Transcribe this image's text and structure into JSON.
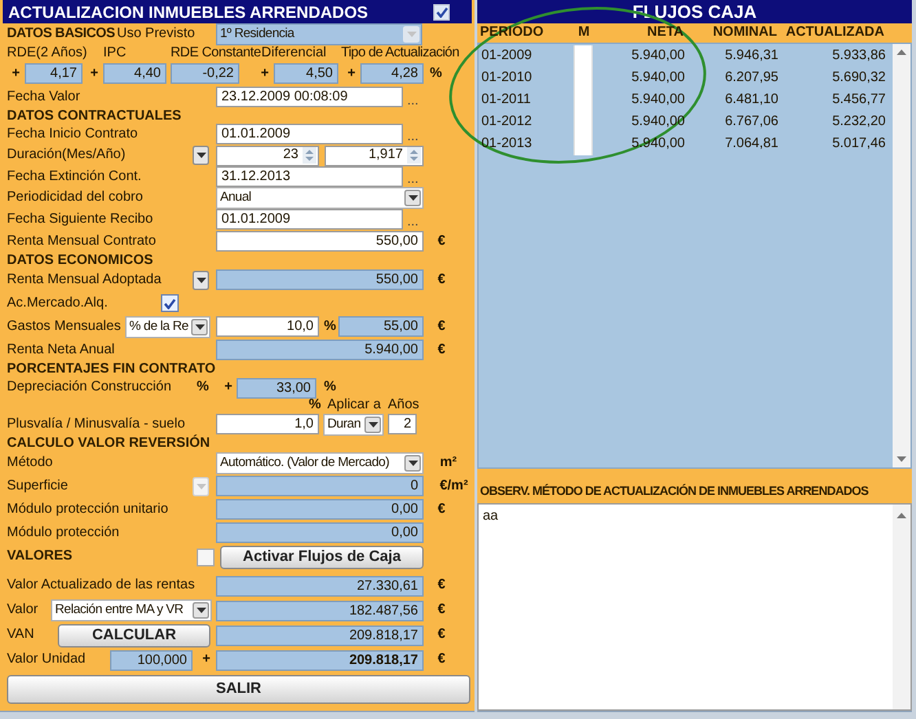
{
  "title": {
    "text": "ACTUALIZACION INMUEBLES ARRENDADOS",
    "checked": true
  },
  "form_rows": [
    {
      "items": [
        {
          "kind": "heading",
          "text": "DATOS BASICOS"
        },
        {
          "kind": "label",
          "text": "Uso Previsto"
        },
        {
          "kind": "select",
          "value": "1º Residencia",
          "editable": false,
          "disabled": true
        }
      ]
    },
    {
      "items": [
        {
          "kind": "label",
          "text": "RDE(2 Años)"
        },
        {
          "kind": "label",
          "text": "IPC"
        },
        {
          "kind": "label",
          "text": "RDE Constante"
        },
        {
          "kind": "label",
          "text": "Diferencial"
        },
        {
          "kind": "label",
          "text": "Tipo de Actualización"
        }
      ]
    },
    {
      "items": [
        {
          "kind": "sign",
          "text": "+"
        },
        {
          "kind": "field",
          "value": "4,17",
          "editable": false
        },
        {
          "kind": "sign",
          "text": "+"
        },
        {
          "kind": "field",
          "value": "4,40",
          "editable": false
        },
        {
          "kind": "field",
          "value": "-0,22",
          "editable": false
        },
        {
          "kind": "sign",
          "text": "+"
        },
        {
          "kind": "field",
          "value": "4,50",
          "editable": false
        },
        {
          "kind": "sign",
          "text": "+"
        },
        {
          "kind": "field",
          "value": "4,28",
          "editable": false
        },
        {
          "kind": "sign",
          "text": "%"
        }
      ]
    },
    {
      "items": [
        {
          "kind": "label",
          "text": "Fecha Valor"
        },
        {
          "kind": "field",
          "value": "23.12.2009 00:08:09",
          "editable": true
        },
        {
          "kind": "ellipsis_button",
          "text": "..."
        }
      ]
    },
    {
      "items": [
        {
          "kind": "heading",
          "text": "DATOS CONTRACTUALES"
        }
      ]
    },
    {
      "items": [
        {
          "kind": "label",
          "text": "Fecha Inicio Contrato"
        },
        {
          "kind": "field",
          "value": "01.01.2009",
          "editable": true
        },
        {
          "kind": "ellipsis_button",
          "text": "..."
        }
      ]
    },
    {
      "items": [
        {
          "kind": "label",
          "text": "Duración(Mes/Año)"
        },
        {
          "kind": "dropdown_button",
          "disabled": false
        },
        {
          "kind": "spinner",
          "value": "23"
        },
        {
          "kind": "spinner",
          "value": "1,917"
        }
      ]
    },
    {
      "items": [
        {
          "kind": "label",
          "text": "Fecha Extinción Cont."
        },
        {
          "kind": "field",
          "value": "31.12.2013",
          "editable": true
        },
        {
          "kind": "ellipsis_button",
          "text": "..."
        }
      ]
    },
    {
      "items": [
        {
          "kind": "label",
          "text": "Periodicidad del cobro"
        },
        {
          "kind": "select",
          "value": "Anual",
          "editable": true,
          "disabled": false
        }
      ]
    },
    {
      "items": [
        {
          "kind": "label",
          "text": "Fecha Siguiente Recibo"
        },
        {
          "kind": "field",
          "value": "01.01.2009",
          "editable": true
        },
        {
          "kind": "ellipsis_button",
          "text": "..."
        }
      ]
    },
    {
      "items": [
        {
          "kind": "label",
          "text": "Renta Mensual Contrato"
        },
        {
          "kind": "field",
          "value": "550,00",
          "editable": true
        },
        {
          "kind": "sign",
          "text": "€"
        }
      ]
    },
    {
      "items": [
        {
          "kind": "heading",
          "text": "DATOS ECONOMICOS"
        }
      ]
    },
    {
      "items": [
        {
          "kind": "label",
          "text": "Renta Mensual Adoptada"
        },
        {
          "kind": "dropdown_button",
          "disabled": false
        },
        {
          "kind": "field",
          "value": "550,00",
          "editable": false
        },
        {
          "kind": "sign",
          "text": "€"
        }
      ]
    },
    {
      "items": [
        {
          "kind": "label",
          "text": "Ac.Mercado.Alq."
        },
        {
          "kind": "checkbox",
          "checked": true
        }
      ]
    },
    {
      "items": [
        {
          "kind": "label",
          "text": "Gastos Mensuales"
        },
        {
          "kind": "select",
          "value": "% de la Re",
          "editable": true,
          "disabled": false
        },
        {
          "kind": "field",
          "value": "10,0",
          "editable": true
        },
        {
          "kind": "sign",
          "text": "%"
        },
        {
          "kind": "field",
          "value": "55,00",
          "editable": false
        },
        {
          "kind": "sign",
          "text": "€"
        }
      ]
    },
    {
      "items": [
        {
          "kind": "label",
          "text": "Renta Neta Anual"
        },
        {
          "kind": "field",
          "value": "5.940,00",
          "editable": false
        },
        {
          "kind": "sign",
          "text": "€"
        }
      ]
    },
    {
      "items": [
        {
          "kind": "heading",
          "text": "PORCENTAJES FIN CONTRATO"
        }
      ]
    },
    {
      "items": [
        {
          "kind": "label",
          "text": "Depreciación Construcción"
        },
        {
          "kind": "sign",
          "text": "%"
        },
        {
          "kind": "sign",
          "text": "+"
        },
        {
          "kind": "field",
          "value": "33,00",
          "editable": false
        },
        {
          "kind": "sign",
          "text": "%"
        }
      ]
    },
    {
      "items": [
        {
          "kind": "sign",
          "text": "%"
        },
        {
          "kind": "label",
          "text": "Aplicar a"
        },
        {
          "kind": "label",
          "text": "Años"
        }
      ]
    },
    {
      "items": [
        {
          "kind": "label",
          "text": "Plusvalía / Minusvalía - suelo"
        },
        {
          "kind": "field",
          "value": "1,0",
          "editable": true
        },
        {
          "kind": "select",
          "value": "Duran",
          "editable": true,
          "disabled": false
        },
        {
          "kind": "field",
          "value": "2",
          "editable": true
        }
      ]
    },
    {
      "items": [
        {
          "kind": "heading",
          "text": "CALCULO VALOR REVERSIÓN"
        }
      ]
    },
    {
      "items": [
        {
          "kind": "label",
          "text": "Método"
        },
        {
          "kind": "select",
          "value": "Automático. (Valor de Mercado)",
          "editable": true,
          "disabled": false
        },
        {
          "kind": "sign",
          "text": "m²"
        }
      ]
    },
    {
      "items": [
        {
          "kind": "label",
          "text": "Superficie"
        },
        {
          "kind": "dropdown_button",
          "disabled": true
        },
        {
          "kind": "field",
          "value": "0",
          "editable": false
        },
        {
          "kind": "sign",
          "text": "€/m²"
        }
      ]
    },
    {
      "items": [
        {
          "kind": "label",
          "text": "Módulo protección unitario"
        },
        {
          "kind": "field",
          "value": "0,00",
          "editable": false
        },
        {
          "kind": "sign",
          "text": "€"
        }
      ]
    },
    {
      "items": [
        {
          "kind": "label",
          "text": "Módulo protección"
        },
        {
          "kind": "field",
          "value": "0,00",
          "editable": false
        }
      ]
    },
    {
      "items": [
        {
          "kind": "heading",
          "text": "VALORES"
        },
        {
          "kind": "checkbox",
          "checked": false
        },
        {
          "kind": "button",
          "text": "Activar Flujos de Caja"
        }
      ]
    },
    {
      "items": [
        {
          "kind": "label",
          "text": "Valor Actualizado de las rentas"
        },
        {
          "kind": "field",
          "value": "27.330,61",
          "editable": false
        },
        {
          "kind": "sign",
          "text": "€"
        }
      ]
    },
    {
      "items": [
        {
          "kind": "label",
          "text": "Valor"
        },
        {
          "kind": "select",
          "value": "Relación entre MA y VR",
          "editable": true,
          "disabled": false
        },
        {
          "kind": "field",
          "value": "182.487,56",
          "editable": false
        },
        {
          "kind": "sign",
          "text": "€"
        }
      ]
    },
    {
      "items": [
        {
          "kind": "label",
          "text": "VAN"
        },
        {
          "kind": "button",
          "text": "CALCULAR"
        },
        {
          "kind": "field",
          "value": "209.818,17",
          "editable": false
        },
        {
          "kind": "sign",
          "text": "€"
        }
      ]
    },
    {
      "items": [
        {
          "kind": "label",
          "text": "Valor Unidad"
        },
        {
          "kind": "field",
          "value": "100,000",
          "editable": false
        },
        {
          "kind": "sign",
          "text": "+"
        },
        {
          "kind": "field",
          "value": "209.818,17",
          "editable": false,
          "emphasis": true
        },
        {
          "kind": "sign",
          "text": "€"
        }
      ]
    },
    {
      "items": [
        {
          "kind": "button",
          "text": "SALIR"
        }
      ]
    }
  ],
  "cash_flows": {
    "title": "FLUJOS CAJA",
    "columns": [
      "PERIODO",
      "M",
      "NETA",
      "NOMINAL",
      "ACTUALIZADA"
    ],
    "rows": [
      {
        "periodo": "01-2009",
        "m": false,
        "neta": "5.940,00",
        "nominal": "5.946,31",
        "actualizada": "5.933,86"
      },
      {
        "periodo": "01-2010",
        "m": false,
        "neta": "5.940,00",
        "nominal": "6.207,95",
        "actualizada": "5.690,32"
      },
      {
        "periodo": "01-2011",
        "m": false,
        "neta": "5.940,00",
        "nominal": "6.481,10",
        "actualizada": "5.456,77"
      },
      {
        "periodo": "01-2012",
        "m": false,
        "neta": "5.940,00",
        "nominal": "6.767,06",
        "actualizada": "5.232,20"
      },
      {
        "periodo": "01-2013",
        "m": false,
        "neta": "5.940,00",
        "nominal": "7.064,81",
        "actualizada": "5.017,46"
      }
    ]
  },
  "notes": {
    "heading": "OBSERV. MÉTODO DE ACTUALIZACIÓN DE INMUEBLES ARRENDADOS",
    "value": "aa"
  }
}
